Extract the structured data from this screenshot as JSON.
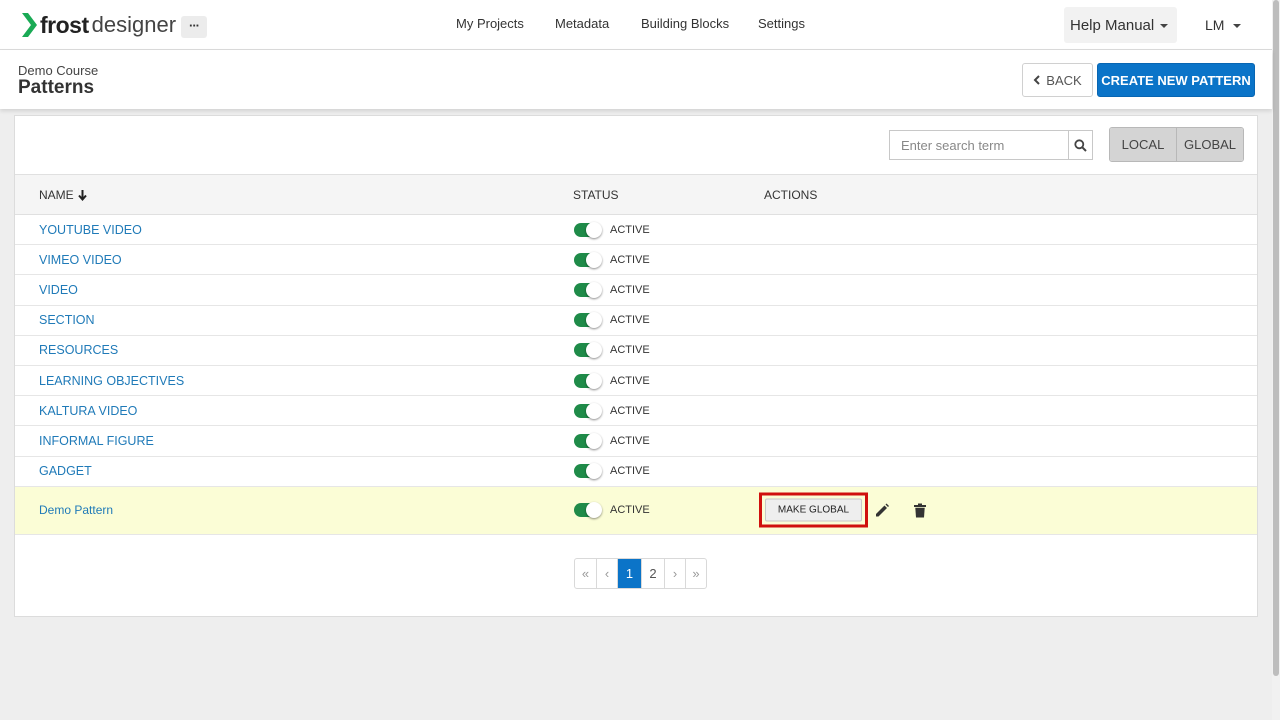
{
  "brand": {
    "frost": "frost",
    "designer": "designer",
    "accent": "#1aaa55"
  },
  "topbar": {
    "more_label": "···",
    "nav": [
      "My Projects",
      "Metadata",
      "Building Blocks",
      "Settings"
    ],
    "help_label": "Help Manual",
    "user_initials": "LM"
  },
  "header": {
    "course": "Demo Course",
    "title": "Patterns",
    "back_label": "BACK",
    "create_label": "CREATE NEW PATTERN"
  },
  "search": {
    "placeholder": "Enter search term",
    "value": ""
  },
  "scope": {
    "local": "LOCAL",
    "global": "GLOBAL"
  },
  "table": {
    "columns": {
      "name": "NAME",
      "status": "STATUS",
      "actions": "ACTIONS"
    },
    "sort_indicator": "down-arrow-icon",
    "rows": [
      {
        "name": "YOUTUBE VIDEO",
        "status": "ACTIVE",
        "enabled": true
      },
      {
        "name": "VIMEO VIDEO",
        "status": "ACTIVE",
        "enabled": true
      },
      {
        "name": "VIDEO",
        "status": "ACTIVE",
        "enabled": true
      },
      {
        "name": "SECTION",
        "status": "ACTIVE",
        "enabled": true
      },
      {
        "name": "RESOURCES",
        "status": "ACTIVE",
        "enabled": true
      },
      {
        "name": "LEARNING OBJECTIVES",
        "status": "ACTIVE",
        "enabled": true
      },
      {
        "name": "KALTURA VIDEO",
        "status": "ACTIVE",
        "enabled": true
      },
      {
        "name": "INFORMAL FIGURE",
        "status": "ACTIVE",
        "enabled": true
      },
      {
        "name": "GADGET",
        "status": "ACTIVE",
        "enabled": true
      },
      {
        "name": "Demo Pattern",
        "status": "ACTIVE",
        "enabled": true,
        "make_global_label": "MAKE GLOBAL",
        "highlighted": true
      }
    ]
  },
  "pagination": {
    "first": "«",
    "prev": "‹",
    "pages": [
      "1",
      "2"
    ],
    "current": "1",
    "next": "›",
    "last": "»"
  },
  "colors": {
    "primary": "#0b74c8",
    "toggle_on": "#1f8b49",
    "link": "#1f7ab8",
    "highlight_row": "#fbfdd6",
    "highlight_border": "#d0100d"
  }
}
